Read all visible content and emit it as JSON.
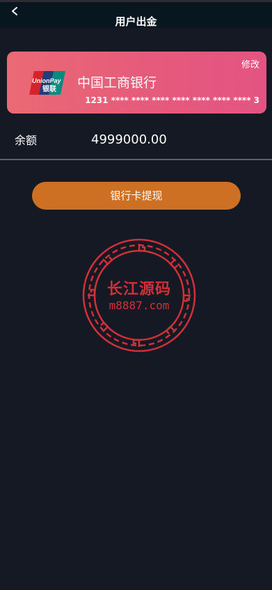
{
  "header": {
    "title": "用户出金",
    "back_icon": "chevron-left-icon"
  },
  "card": {
    "bank_name": "中国工商银行",
    "edit_label": "修改",
    "card_number": "1231 **** **** **** **** **** **** **** 3",
    "logo": {
      "line1": "UnionPay",
      "line2": "银联"
    },
    "colors": {
      "gradient_start": "#ea6a74",
      "gradient_end": "#e45482"
    }
  },
  "balance": {
    "label": "余额",
    "value": "4999000.00"
  },
  "withdraw_button": {
    "label": "银行卡提现",
    "color": "#cd7024"
  },
  "watermark": {
    "text_cn": "长江源码",
    "text_url": "m8887.com",
    "color": "#d1303b"
  }
}
